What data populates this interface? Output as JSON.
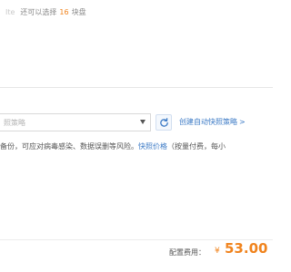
{
  "top": {
    "ghost_text": "Ite",
    "remain_prefix": "还可以选择",
    "remain_count": "16",
    "remain_suffix": "块盘"
  },
  "snapshot": {
    "policy_placeholder": "照策略",
    "create_link": "创建自动快照策略",
    "create_link_arrow": ">",
    "desc_text": "备份，可应对病毒感染、数据误删等风险。",
    "price_link": "快照价格",
    "price_note": "（按量付费，每小"
  },
  "footer": {
    "fee_label": "配置费用：",
    "currency": "¥",
    "amount": "53.00"
  },
  "colors": {
    "accent_orange": "#f0831d",
    "link_blue": "#3d7bc6"
  },
  "icons": {
    "caret": "chevron-down-icon",
    "refresh": "refresh-icon"
  }
}
